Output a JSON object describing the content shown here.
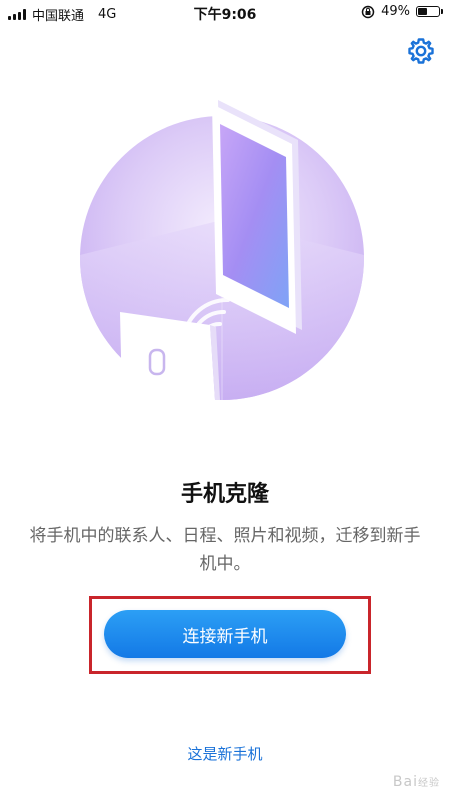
{
  "status_bar": {
    "carrier": "中国联通",
    "network": "4G",
    "time": "下午9:06",
    "battery_percent": "49%",
    "battery_level": 0.49
  },
  "header": {
    "settings_icon": "gear-icon"
  },
  "main": {
    "title": "手机克隆",
    "description": "将手机中的联系人、日程、照片和视频，迁移到新手机中。",
    "connect_button_label": "连接新手机",
    "new_phone_link": "这是新手机"
  },
  "watermark": {
    "text": "Bai",
    "suffix": "经验"
  },
  "colors": {
    "accent": "#1a7ee8",
    "highlight_box": "#c9252b",
    "illustration_purple": "#c9b0f2"
  }
}
